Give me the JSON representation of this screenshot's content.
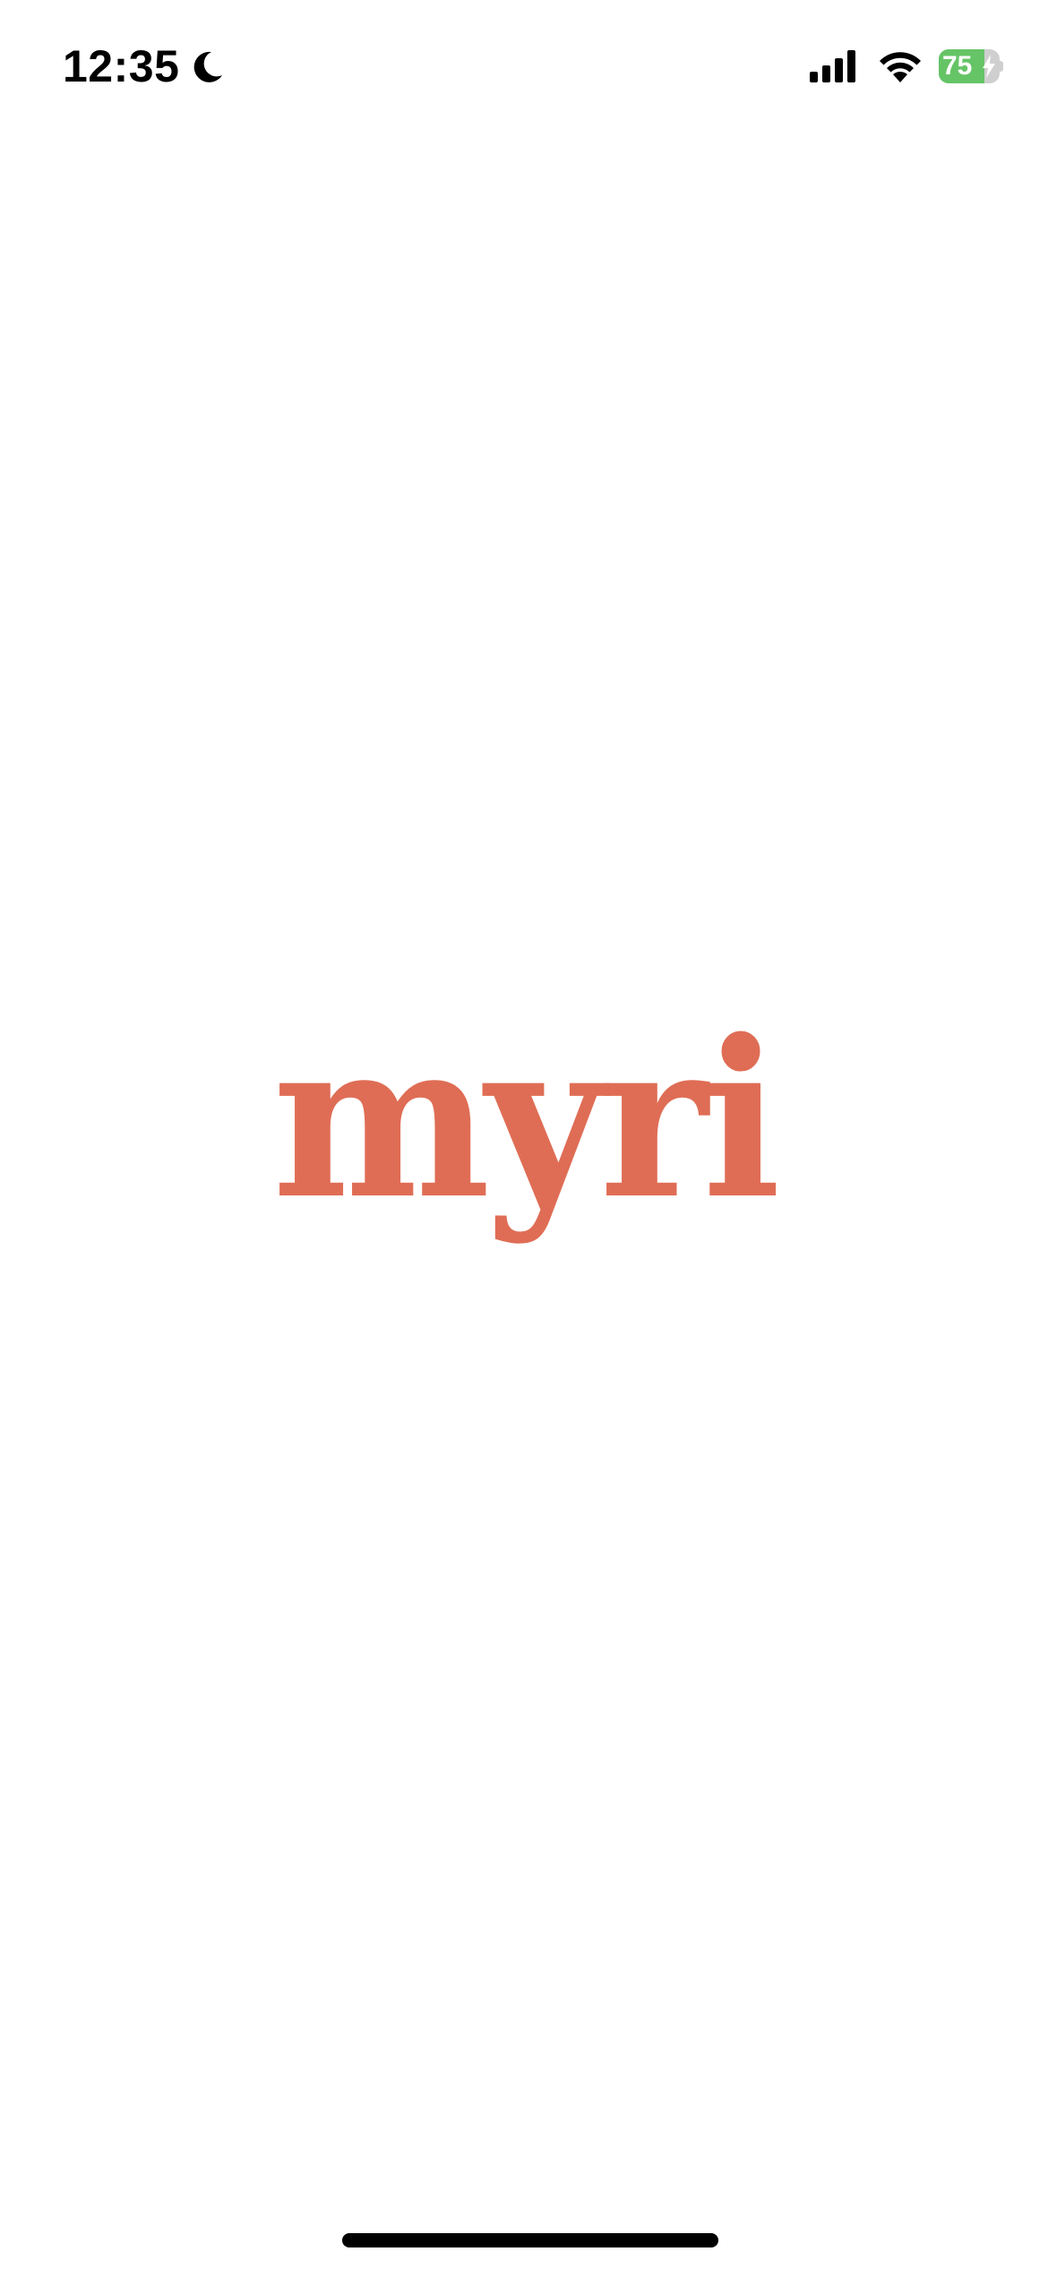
{
  "status_bar": {
    "time": "12:35",
    "moon_icon": "moon-icon",
    "signal_icon": "cellular-signal-icon",
    "wifi_icon": "wifi-icon",
    "battery_level": "75",
    "battery_fraction": 0.75,
    "charging_icon": "bolt-icon"
  },
  "splash": {
    "brand_name": "myri"
  },
  "colors": {
    "background": "#ffffff",
    "brand": "#df6d55",
    "battery_green": "#65c466",
    "text": "#000000"
  }
}
